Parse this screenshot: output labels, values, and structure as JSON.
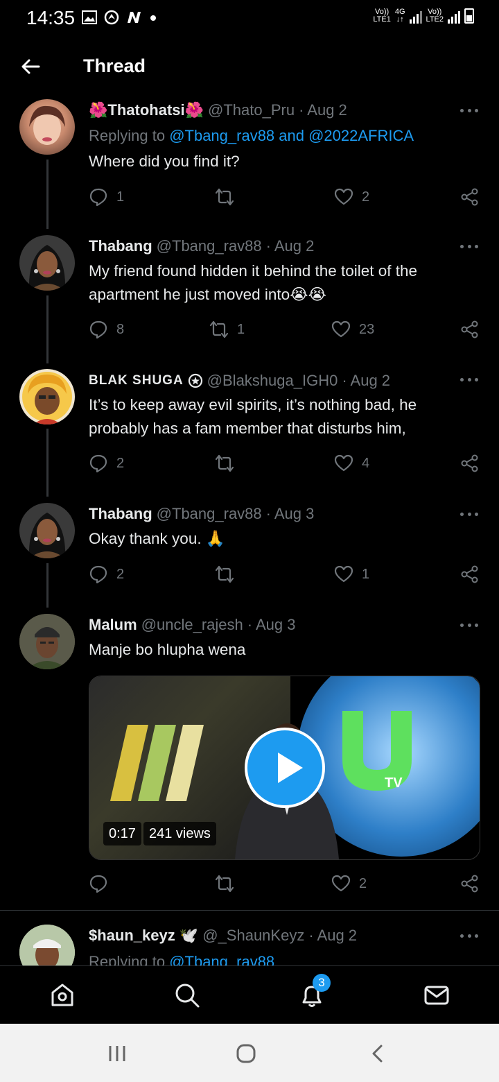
{
  "status_bar": {
    "time": "14:35",
    "net1": "Vo))",
    "net1_sub": "LTE1",
    "net_type": "4G",
    "net2": "Vo))",
    "net2_sub": "LTE2"
  },
  "header": {
    "title": "Thread"
  },
  "tweets": [
    {
      "name": "🌺Thatohatsi🌺",
      "handle": "@Thato_Pru",
      "date": "· Aug 2",
      "replying_prefix": "Replying to ",
      "replying_to": "@Tbang_rav88 and @2022AFRICA",
      "text": "Where did you find it?",
      "replies": "1",
      "retweets": "",
      "likes": "2"
    },
    {
      "name": "Thabang",
      "handle": "@Tbang_rav88",
      "date": "· Aug 2",
      "text": "My friend found hidden it behind the toilet of the apartment he  just moved into😭😭",
      "replies": "8",
      "retweets": "1",
      "likes": "23"
    },
    {
      "name": "BLAK SHUGA",
      "handle": "@Blakshuga_IGH0",
      "date": "· Aug 2",
      "text": "It’s to keep away evil spirits, it’s nothing bad, he probably has a fam member that disturbs him,",
      "replies": "2",
      "retweets": "",
      "likes": "4"
    },
    {
      "name": "Thabang",
      "handle": "@Tbang_rav88",
      "date": "· Aug 3",
      "text": "Okay thank you. 🙏",
      "replies": "2",
      "retweets": "",
      "likes": "1"
    },
    {
      "name": "Malum",
      "handle": "@uncle_rajesh",
      "date": "· Aug 3",
      "text": "Manje bo hlupha wena",
      "replies": "",
      "retweets": "",
      "likes": "2",
      "video": {
        "duration": "0:17",
        "views": "241 views"
      }
    },
    {
      "name": "$haun_keyz 🕊️",
      "handle": "@_ShaunKeyz",
      "date": "· Aug 2",
      "replying_prefix": "Replying to ",
      "replying_to": "@Tbang_rav88"
    }
  ],
  "bottom_nav": {
    "notifications_badge": "3"
  },
  "colors": {
    "accent": "#1d9bf0",
    "background": "#000000",
    "muted": "#71767b"
  }
}
